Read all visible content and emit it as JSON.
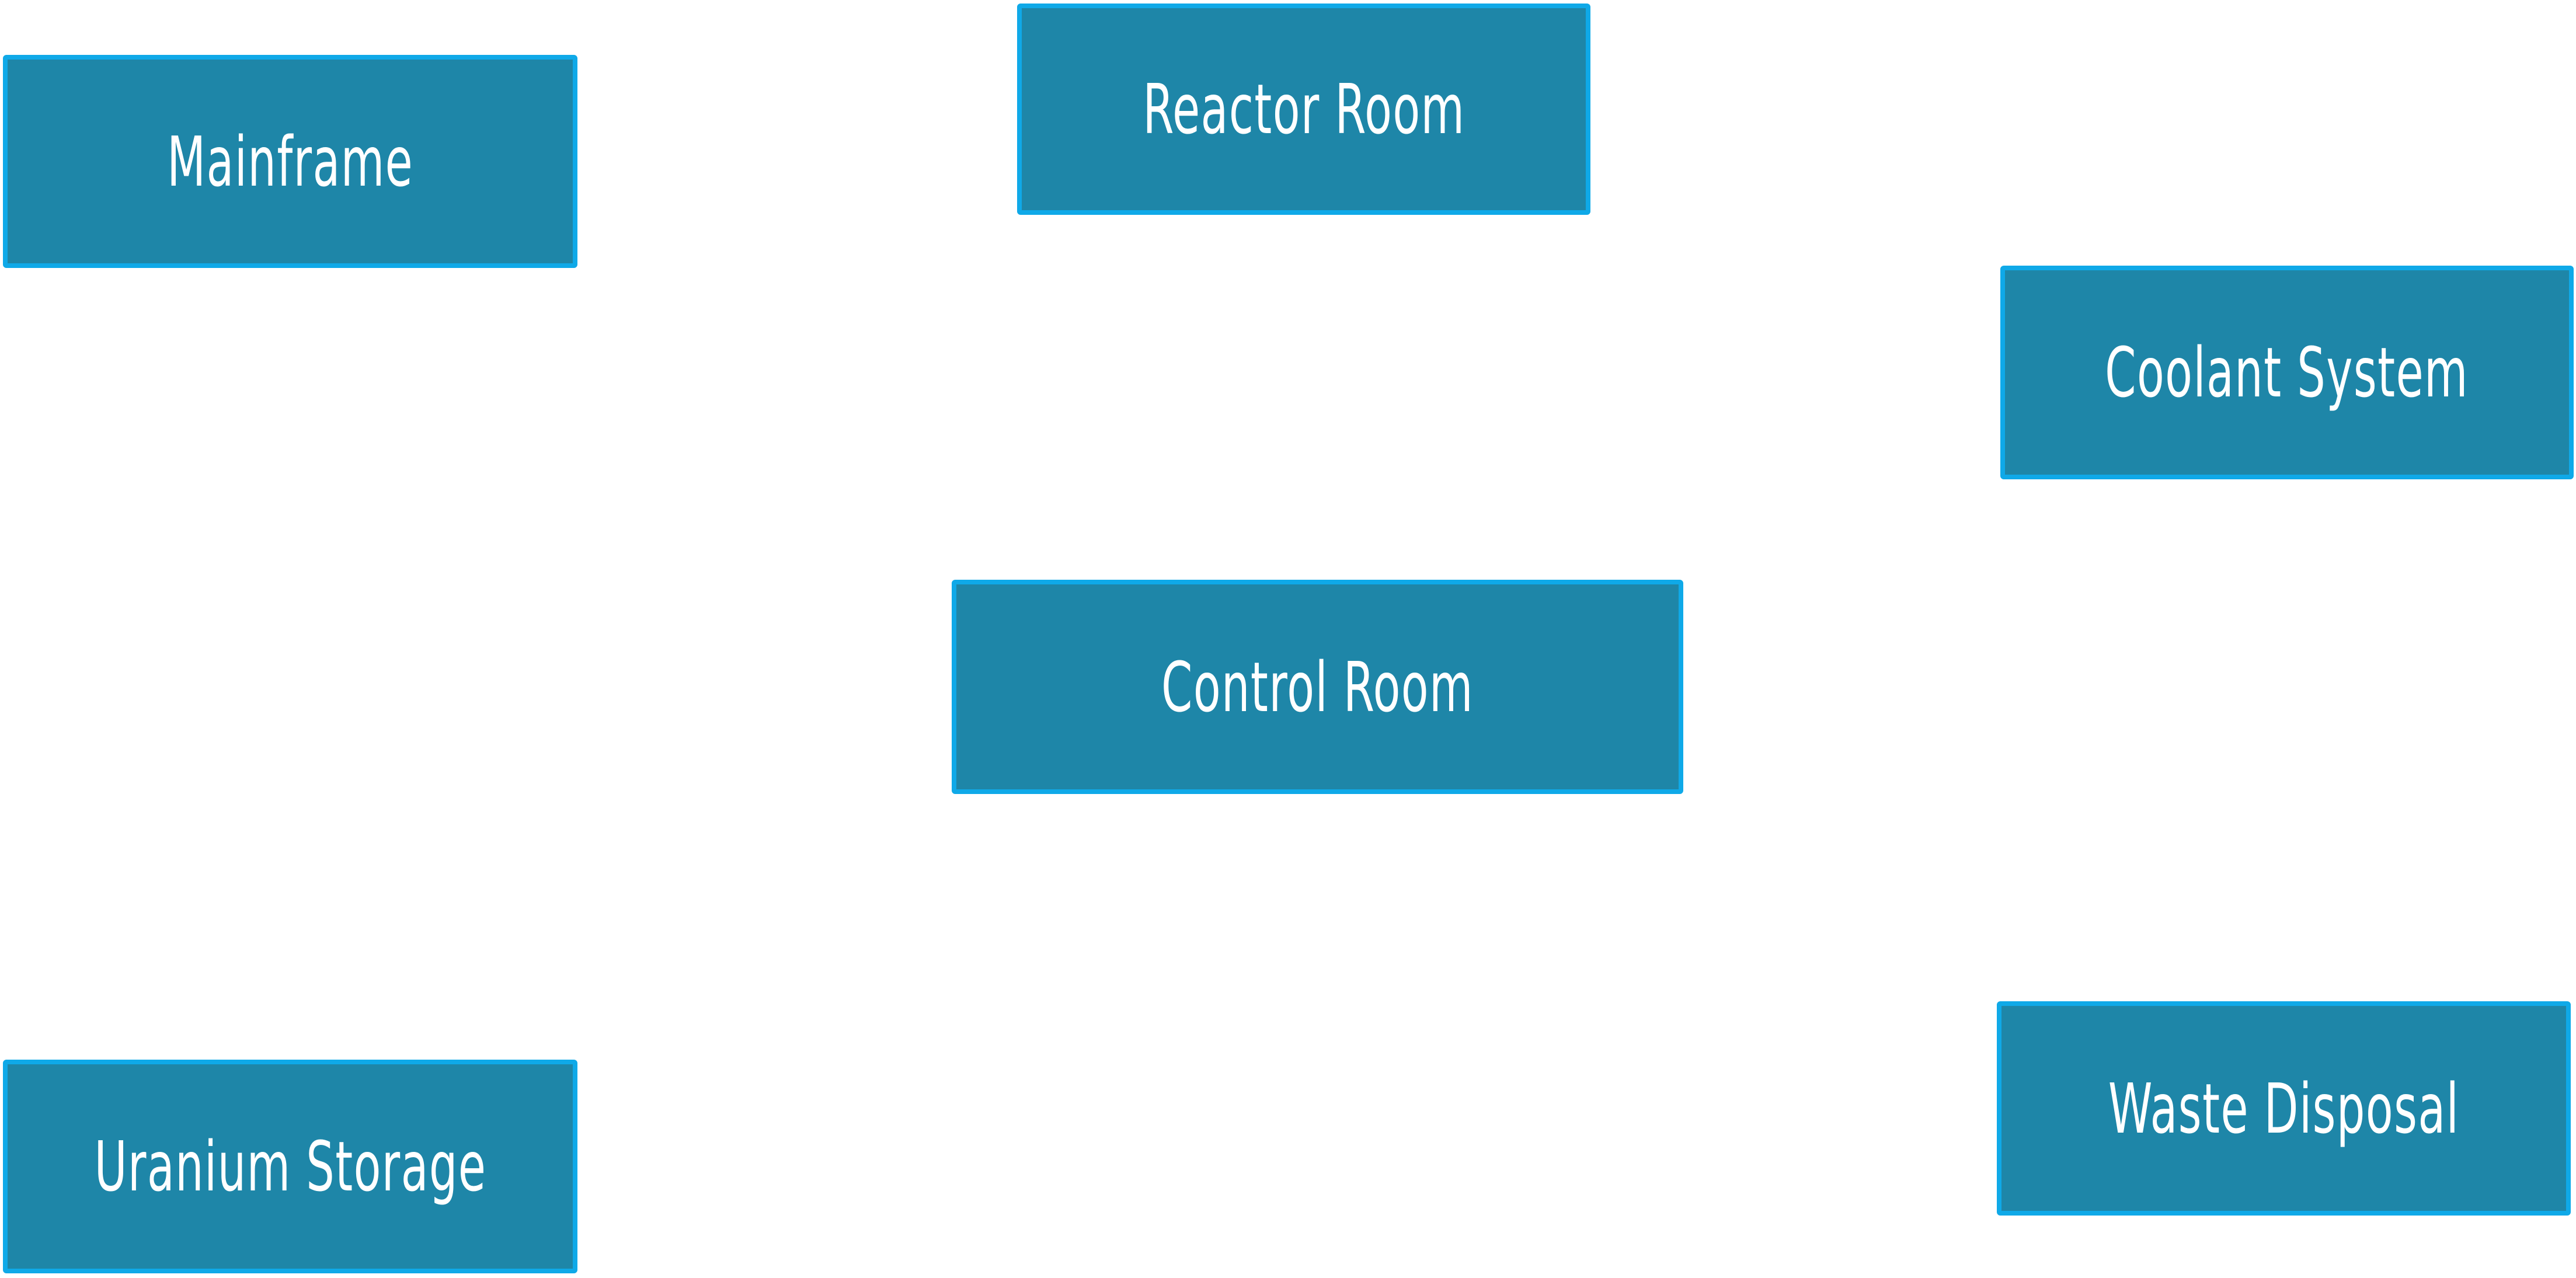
{
  "diagram": {
    "colors": {
      "node_fill": "#1e86a8",
      "node_border": "#0fa9e8",
      "label": "#ffffff",
      "background": "#ffffff"
    },
    "nodes": [
      {
        "id": "mainframe",
        "label": "Mainframe"
      },
      {
        "id": "reactor-room",
        "label": "Reactor Room"
      },
      {
        "id": "coolant-system",
        "label": "Coolant System"
      },
      {
        "id": "control-room",
        "label": "Control Room"
      },
      {
        "id": "uranium-storage",
        "label": "Uranium Storage"
      },
      {
        "id": "waste-disposal",
        "label": "Waste Disposal"
      }
    ]
  }
}
